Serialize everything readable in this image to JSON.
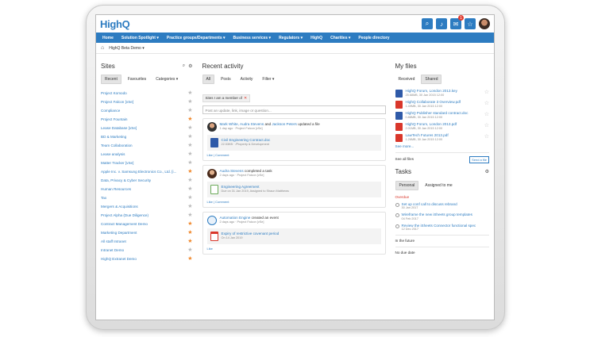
{
  "app": {
    "logo": "HighQ"
  },
  "top_icons": {
    "notif_count": "1"
  },
  "nav": [
    "Home",
    "Solution Spotlight ▾",
    "Practice groups/Departments ▾",
    "Business services ▾",
    "Regulators ▾",
    "HighQ",
    "Charities ▾",
    "People directory"
  ],
  "breadcrumb": {
    "label": "HighQ Beta Demo ▾"
  },
  "sites": {
    "title": "Sites",
    "tabs": [
      "Recent",
      "Favourites",
      "Categories ▾"
    ],
    "items": [
      {
        "name": "Project Komodo",
        "fav": false
      },
      {
        "name": "Project Falcon [vSe]",
        "fav": false
      },
      {
        "name": "Compliance",
        "fav": false
      },
      {
        "name": "Project Fountain",
        "fav": true
      },
      {
        "name": "Lease Database [vSe]",
        "fav": false
      },
      {
        "name": "BD & Marketing",
        "fav": false
      },
      {
        "name": "Team Collaboration",
        "fav": false
      },
      {
        "name": "Lease analysis",
        "fav": false
      },
      {
        "name": "Matter Tracker [vSe]",
        "fav": false
      },
      {
        "name": "Apple Inc. v. Samsung Electronics Co., Ltd. [i...",
        "fav": true
      },
      {
        "name": "Data, Privacy & Cyber Security",
        "fav": false
      },
      {
        "name": "Human Resources",
        "fav": false
      },
      {
        "name": "Tax",
        "fav": false
      },
      {
        "name": "Mergers & Acquisitions",
        "fav": false
      },
      {
        "name": "Project Alpha (Due Diligence)",
        "fav": false
      },
      {
        "name": "Contract Management Demo",
        "fav": true
      },
      {
        "name": "Marketing Department",
        "fav": true
      },
      {
        "name": "All staff Intranet",
        "fav": true
      },
      {
        "name": "Intranet Demo",
        "fav": false
      },
      {
        "name": "HighQ Extranet Demo",
        "fav": true
      }
    ]
  },
  "activity": {
    "title": "Recent activity",
    "tabs": [
      "All",
      "Posts",
      "Activity",
      "Filter ▾"
    ],
    "chip": "Sites I am a member of",
    "share_placeholder": "Post an update, link, image or question...",
    "cards": [
      {
        "line_a": "Mark White, Audra Stevens",
        "line_b": " and ",
        "line_c": "Jackson Peters",
        "line_d": " updated a file",
        "meta": "1 day ago · Project Falcon [vSe]",
        "item_title": "Civil Engineering Contract.doc",
        "item_meta": "22.53KB · /Property & Development",
        "actions": "Like | Comment"
      },
      {
        "line_a": "Audra Stevens",
        "line_d": " completed a task",
        "meta": "2 days ago · Project Falcon [vSe]",
        "item_title": "Engineering Agreement",
        "item_meta": "Due on 31 Jan 2019, Assigned to Shaun Matthews",
        "actions": "Like | Comment"
      },
      {
        "line_a": "Automation Engine",
        "line_d": " created an event",
        "meta": "2 days ago · Project Falcon [vSe]",
        "item_title": "Expiry of restrictive covenant period",
        "item_meta": "On 14 Jan 2019",
        "actions": "Like"
      }
    ]
  },
  "files": {
    "title": "My files",
    "tabs": [
      "Received",
      "Shared"
    ],
    "items": [
      {
        "name": "HighQ Forum, London 2013.key",
        "meta": "25.68MB, 30 Jan 2015 12:00",
        "kind": "doc"
      },
      {
        "name": "HighQ Collaborate 3 Overview.pdf",
        "meta": "1.49MB, 30 Jan 2015 12:00",
        "kind": "pdf"
      },
      {
        "name": "HighQ Publisher standard contract.doc",
        "meta": "0.88MB, 30 Jan 2015 12:00",
        "kind": "doc"
      },
      {
        "name": "HighQ Forum, London 2013.pdf",
        "meta": "2.01MB, 30 Jan 2015 12:00",
        "kind": "pdf"
      },
      {
        "name": "LawTech Futures 2013.pdf",
        "meta": "1.26MB, 30 Jan 2015 12:00",
        "kind": "pdf"
      }
    ],
    "see_more": "See more...",
    "see_all": "See all files",
    "send_label": "Send a file"
  },
  "tasks": {
    "title": "Tasks",
    "tabs": [
      "Personal",
      "Assigned to me"
    ],
    "overdue_label": "Overdue",
    "items": [
      {
        "name": "Set up conf call to discuss rebrand",
        "date": "30 Jan 2017"
      },
      {
        "name": "Wireframe the new iSheets group templates",
        "date": "04 Feb 2017"
      },
      {
        "name": "Review the iSheets Connector functional spec",
        "date": "12 Dec 2017"
      }
    ],
    "future_label": "In the future",
    "no_date_label": "No due date"
  },
  "colors": {
    "brand": "#2d7cc1",
    "favourite": "#f0882c",
    "pdf": "#d9372b"
  }
}
